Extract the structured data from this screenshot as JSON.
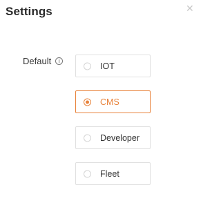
{
  "title": "Settings",
  "close_icon": "close-icon",
  "field": {
    "label": "Default",
    "info_icon": "info-icon"
  },
  "options": [
    {
      "label": "IOT",
      "selected": false
    },
    {
      "label": "CMS",
      "selected": true
    },
    {
      "label": "Developer",
      "selected": false
    },
    {
      "label": "Fleet",
      "selected": false
    }
  ],
  "colors": {
    "accent": "#e8823a",
    "border": "#e0e0e0",
    "text": "#333333"
  }
}
